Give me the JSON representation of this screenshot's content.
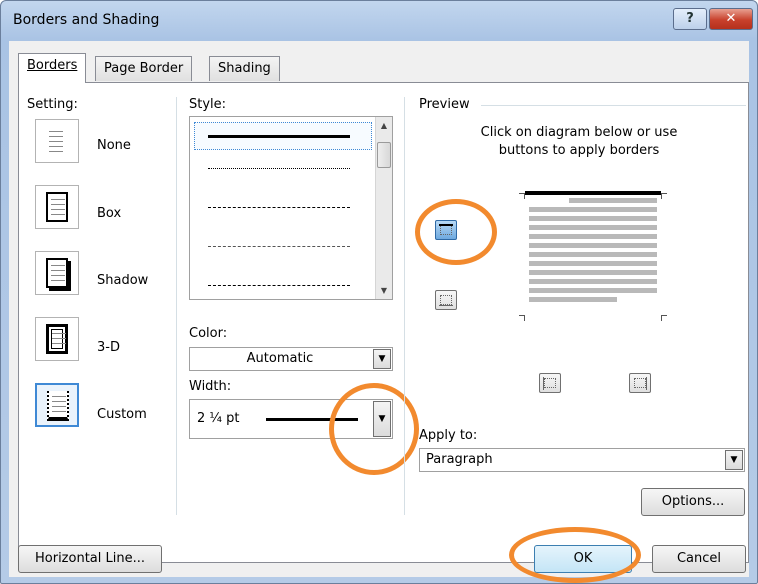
{
  "window": {
    "title": "Borders and Shading",
    "help_label": "?",
    "close_label": "✕"
  },
  "tabs": [
    {
      "label": "Borders",
      "underline": "B",
      "active": true
    },
    {
      "label": "Page Border",
      "underline": "P",
      "active": false
    },
    {
      "label": "Shading",
      "underline": "S",
      "active": false
    }
  ],
  "setting": {
    "heading": "Setting:",
    "items": [
      {
        "label": "None",
        "selected": false
      },
      {
        "label": "Box",
        "selected": false
      },
      {
        "label": "Shadow",
        "selected": false
      },
      {
        "label": "3-D",
        "selected": false
      },
      {
        "label": "Custom",
        "selected": true
      }
    ]
  },
  "style": {
    "heading": "Style:",
    "selected_index": 0
  },
  "color": {
    "heading": "Color:",
    "value": "Automatic"
  },
  "width": {
    "heading": "Width:",
    "value": "2 ¼ pt"
  },
  "preview": {
    "heading": "Preview",
    "instructions_1": "Click on diagram below or use",
    "instructions_2": "buttons to apply borders"
  },
  "apply_to": {
    "heading": "Apply to:",
    "value": "Paragraph"
  },
  "buttons": {
    "options": "Options...",
    "horizontal_line": "Horizontal Line...",
    "ok": "OK",
    "cancel": "Cancel"
  },
  "colors": {
    "highlight": "#f28a2e",
    "accent": "#3f89d5"
  }
}
